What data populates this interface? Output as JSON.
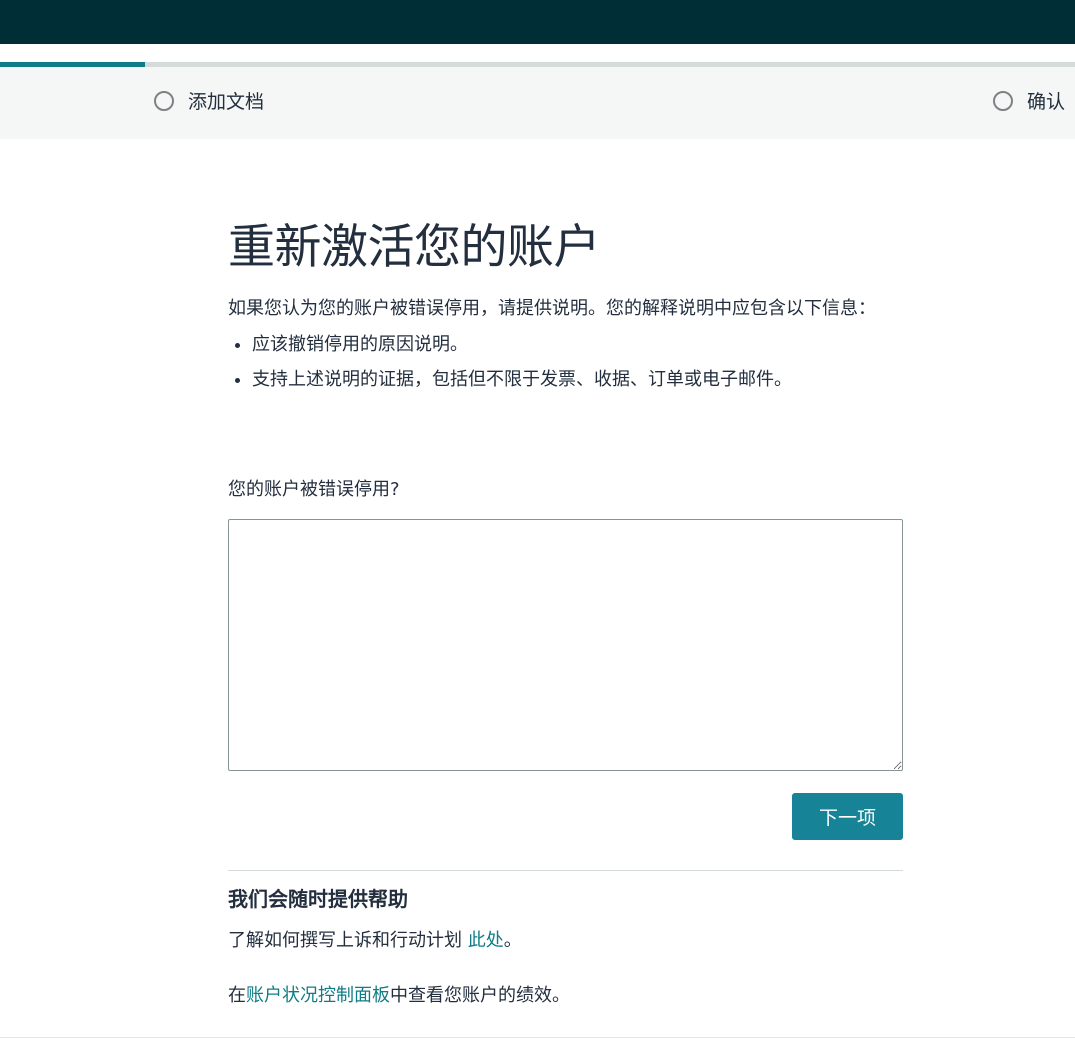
{
  "progress": {
    "fraction": 0.135
  },
  "steps": [
    {
      "label": "添加文档"
    },
    {
      "label": "确认"
    }
  ],
  "page": {
    "title": "重新激活您的账户",
    "intro": "如果您认为您的账户被错误停用，请提供说明。您的解释说明中应包含以下信息：",
    "bullets": [
      "应该撤销停用的原因说明。",
      "支持上述说明的证据，包括但不限于发票、收据、订单或电子邮件。"
    ],
    "field_label": "您的账户被错误停用?",
    "field_value": "",
    "next_label": "下一项"
  },
  "help": {
    "title": "我们会随时提供帮助",
    "line1_prefix": "了解如何撰写上诉和行动计划 ",
    "line1_link": "此处",
    "line1_suffix": "。",
    "line2_prefix": "在",
    "line2_link": "账户状况控制面板",
    "line2_suffix": "中查看您账户的绩效。"
  },
  "colors": {
    "topbar": "#002e36",
    "accent": "#0f7c86",
    "button": "#168396"
  }
}
